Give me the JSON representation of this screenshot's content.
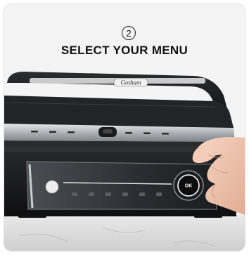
{
  "step": {
    "number": "2",
    "title": "SELECT YOUR MENU"
  },
  "appliance": {
    "brand_logo": "Gotham",
    "dial_label": "OK"
  },
  "colors": {
    "background": "#f4f4f4",
    "grill_body": "#1d1d1f",
    "steel": "#b8bcc0",
    "panel_glass": "#2a2d31",
    "countertop": "#dcdcdc"
  }
}
